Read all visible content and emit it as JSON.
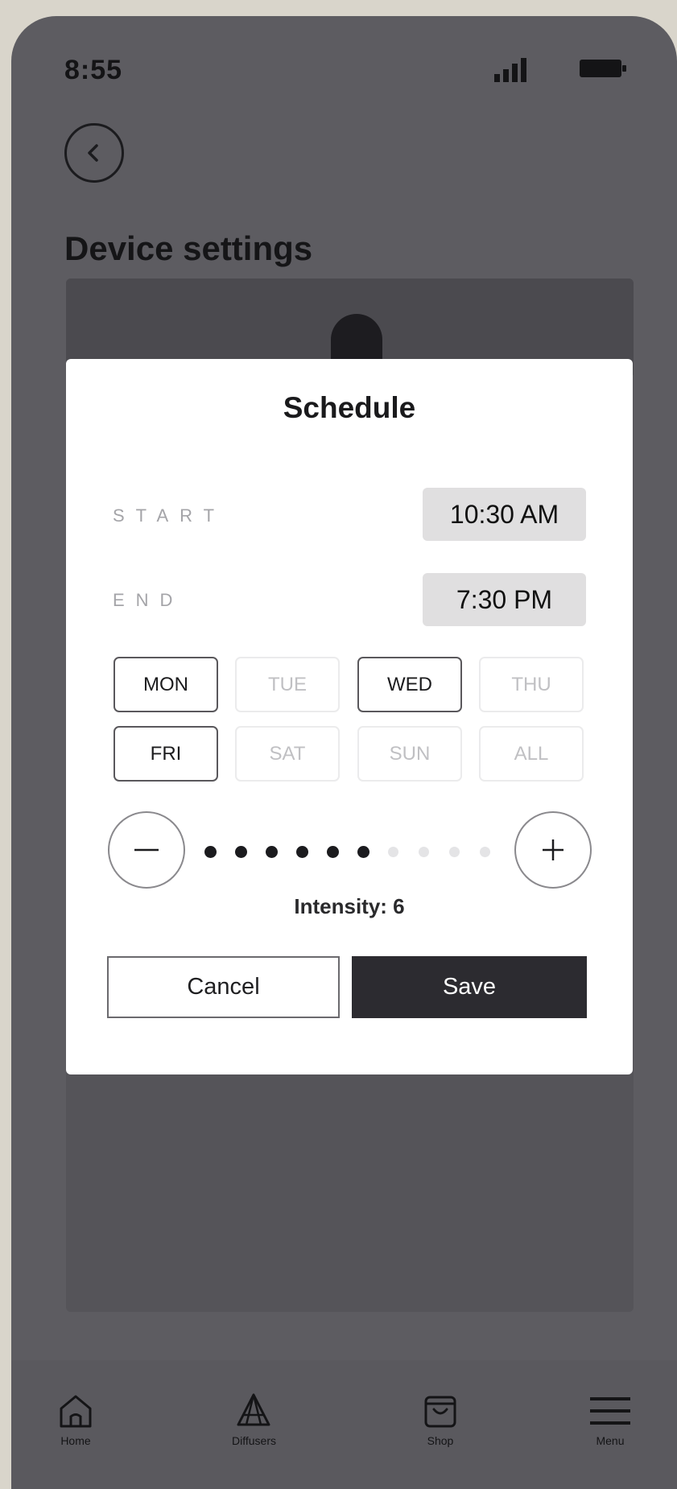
{
  "status_bar": {
    "time": "8:55"
  },
  "header": {
    "title": "Device settings"
  },
  "modal": {
    "title": "Schedule",
    "start": {
      "label": "START",
      "value": "10:30 AM"
    },
    "end": {
      "label": "END",
      "value": "7:30 PM"
    },
    "days": [
      {
        "label": "MON",
        "selected": true
      },
      {
        "label": "TUE",
        "selected": false
      },
      {
        "label": "WED",
        "selected": true
      },
      {
        "label": "THU",
        "selected": false
      },
      {
        "label": "FRI",
        "selected": true
      },
      {
        "label": "SAT",
        "selected": false
      },
      {
        "label": "SUN",
        "selected": false
      },
      {
        "label": "ALL",
        "selected": false
      }
    ],
    "intensity": {
      "text": "Intensity: 6",
      "level": 6,
      "max": 10
    },
    "cancel_label": "Cancel",
    "save_label": "Save"
  },
  "bottom_nav": [
    {
      "label": "Home",
      "icon": "home-icon"
    },
    {
      "label": "Diffusers",
      "icon": "diffuser-icon"
    },
    {
      "label": "Shop",
      "icon": "shopping-bag-icon"
    },
    {
      "label": "Menu",
      "icon": "menu-icon"
    }
  ],
  "colors": {
    "overlay": "#5d5c61",
    "modal_bg": "#ffffff",
    "primary_button": "#2c2b30",
    "chip_bg": "#e0dfe0"
  }
}
